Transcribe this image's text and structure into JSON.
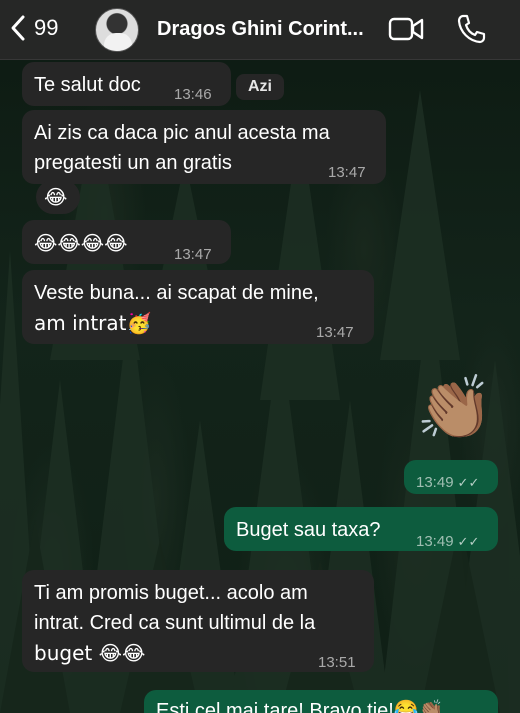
{
  "header": {
    "back_count": "99",
    "contact_name": "Dragos Ghini Corint...",
    "icons": [
      "back-chevron-icon",
      "video-call-icon",
      "phone-call-icon"
    ]
  },
  "day_chip": "Azi",
  "messages": [
    {
      "dir": "in",
      "text": "Te salut doc",
      "time": "13:46"
    },
    {
      "dir": "in",
      "text_line1": "Ai zis ca daca pic anul acesta ma",
      "text_line2": "pregatesti un an gratis",
      "time": "13:47"
    },
    {
      "dir": "in",
      "reaction": "😂"
    },
    {
      "dir": "in",
      "text": "😂😂😂😂",
      "time": "13:47"
    },
    {
      "dir": "in",
      "text_line1": "Veste buna... ai scapat de mine,",
      "text_line2": "am intrat🥳",
      "time": "13:47"
    },
    {
      "dir": "out",
      "text": "👏🏽",
      "time": "13:49",
      "status": "read"
    },
    {
      "dir": "out",
      "text": "Buget sau taxa?",
      "time": "13:49",
      "status": "read"
    },
    {
      "dir": "in",
      "text_line1": "Ti am promis buget... acolo am",
      "text_line2": "intrat. Cred ca sunt ultimul de la",
      "text_line3": "buget 😂😂",
      "time": "13:51"
    },
    {
      "dir": "out",
      "text": "Esti cel mai tare! Bravo tie!😂👏🏽"
    }
  ],
  "colors": {
    "incoming_bubble": "#262626",
    "outgoing_bubble": "#0d5c3e",
    "header_bg": "#282828"
  }
}
